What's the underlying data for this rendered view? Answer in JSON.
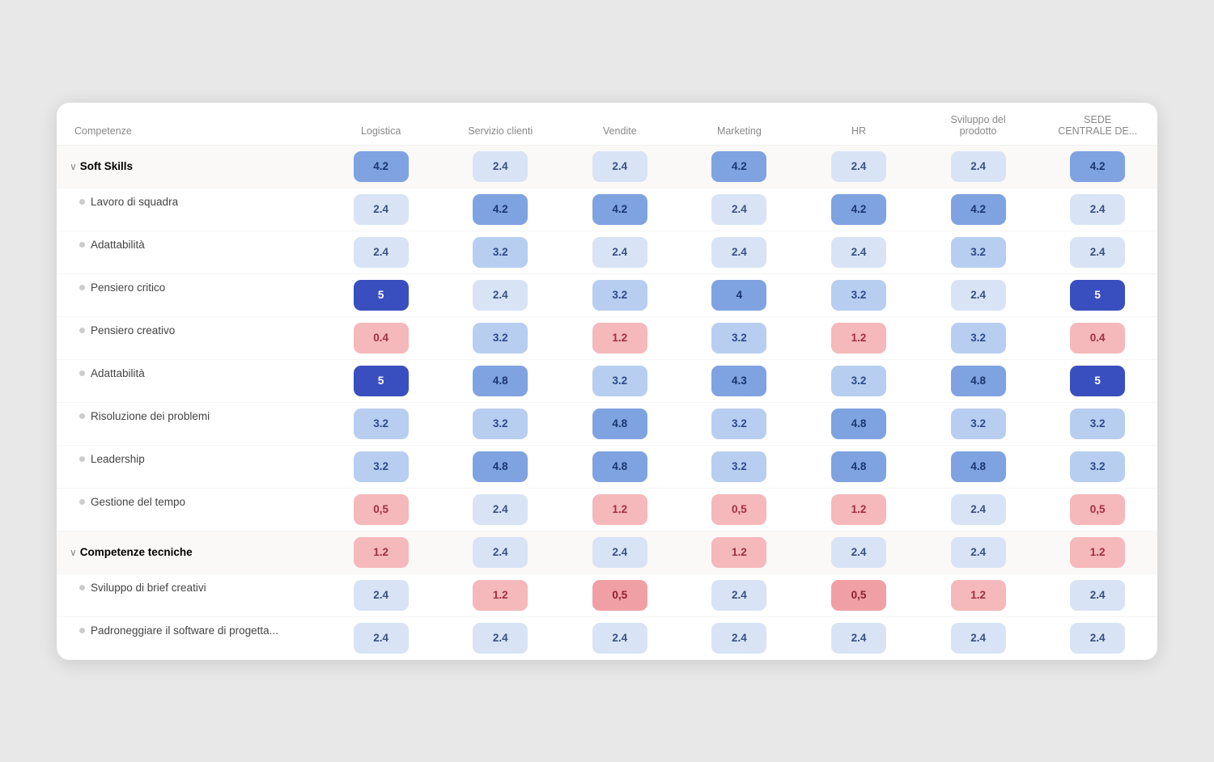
{
  "table": {
    "columns": [
      {
        "id": "competenze",
        "label": "Competenze"
      },
      {
        "id": "logistica",
        "label": "Logistica"
      },
      {
        "id": "servizio",
        "label": "Servizio clienti"
      },
      {
        "id": "vendite",
        "label": "Vendite"
      },
      {
        "id": "marketing",
        "label": "Marketing"
      },
      {
        "id": "hr",
        "label": "HR"
      },
      {
        "id": "sviluppo",
        "label": "Sviluppo del\nprodotto"
      },
      {
        "id": "sede",
        "label": "SEDE\nCENTRALE DE..."
      }
    ],
    "groups": [
      {
        "label": "Soft Skills",
        "values": [
          "4.2",
          "2.4",
          "2.4",
          "4.2",
          "2.4",
          "2.4",
          "4.2"
        ],
        "colors": [
          "c-blue-medium",
          "c-neutral",
          "c-neutral",
          "c-blue-medium",
          "c-neutral",
          "c-neutral",
          "c-blue-medium"
        ],
        "rows": [
          {
            "label": "Lavoro di squadra",
            "values": [
              "2.4",
              "4.2",
              "4.2",
              "2.4",
              "4.2",
              "4.2",
              "2.4"
            ],
            "colors": [
              "c-neutral",
              "c-blue-medium",
              "c-blue-medium",
              "c-neutral",
              "c-blue-medium",
              "c-blue-medium",
              "c-neutral"
            ]
          },
          {
            "label": "Adattabilità",
            "values": [
              "2.4",
              "3.2",
              "2.4",
              "2.4",
              "2.4",
              "3.2",
              "2.4"
            ],
            "colors": [
              "c-neutral",
              "c-blue-light",
              "c-neutral",
              "c-neutral",
              "c-neutral",
              "c-blue-light",
              "c-neutral"
            ]
          },
          {
            "label": "Pensiero critico",
            "values": [
              "5",
              "2.4",
              "3.2",
              "4",
              "3.2",
              "2.4",
              "5"
            ],
            "colors": [
              "c-blue-deep",
              "c-neutral",
              "c-blue-light",
              "c-blue-medium",
              "c-blue-light",
              "c-neutral",
              "c-blue-deep"
            ]
          },
          {
            "label": "Pensiero creativo",
            "values": [
              "0.4",
              "3.2",
              "1.2",
              "3.2",
              "1.2",
              "3.2",
              "0.4"
            ],
            "colors": [
              "c-pink-light",
              "c-blue-light",
              "c-pink-light",
              "c-blue-light",
              "c-pink-light",
              "c-blue-light",
              "c-pink-light"
            ]
          },
          {
            "label": "Adattabilità",
            "values": [
              "5",
              "4.8",
              "3.2",
              "4.3",
              "3.2",
              "4.8",
              "5"
            ],
            "colors": [
              "c-blue-deep",
              "c-blue-medium",
              "c-blue-light",
              "c-blue-medium",
              "c-blue-light",
              "c-blue-medium",
              "c-blue-deep"
            ]
          },
          {
            "label": "Risoluzione dei problemi",
            "values": [
              "3.2",
              "3.2",
              "4.8",
              "3.2",
              "4.8",
              "3.2",
              "3.2"
            ],
            "colors": [
              "c-blue-light",
              "c-blue-light",
              "c-blue-medium",
              "c-blue-light",
              "c-blue-medium",
              "c-blue-light",
              "c-blue-light"
            ]
          },
          {
            "label": "Leadership",
            "values": [
              "3.2",
              "4.8",
              "4.8",
              "3.2",
              "4.8",
              "4.8",
              "3.2"
            ],
            "colors": [
              "c-blue-light",
              "c-blue-medium",
              "c-blue-medium",
              "c-blue-light",
              "c-blue-medium",
              "c-blue-medium",
              "c-blue-light"
            ]
          },
          {
            "label": "Gestione del tempo",
            "values": [
              "0,5",
              "2.4",
              "1.2",
              "0,5",
              "1.2",
              "2.4",
              "0,5"
            ],
            "colors": [
              "c-pink-light",
              "c-neutral",
              "c-pink-light",
              "c-pink-light",
              "c-pink-light",
              "c-neutral",
              "c-pink-light"
            ]
          }
        ]
      },
      {
        "label": "Competenze tecniche",
        "values": [
          "1.2",
          "2.4",
          "2.4",
          "1.2",
          "2.4",
          "2.4",
          "1.2"
        ],
        "colors": [
          "c-pink-light",
          "c-neutral",
          "c-neutral",
          "c-pink-light",
          "c-neutral",
          "c-neutral",
          "c-pink-light"
        ],
        "rows": [
          {
            "label": "Sviluppo di brief creativi",
            "values": [
              "2.4",
              "1.2",
              "0,5",
              "2.4",
              "0,5",
              "1.2",
              "2.4"
            ],
            "colors": [
              "c-neutral",
              "c-pink-light",
              "c-pink-medium",
              "c-neutral",
              "c-pink-medium",
              "c-pink-light",
              "c-neutral"
            ]
          },
          {
            "label": "Padroneggiare il software di progetta...",
            "values": [
              "2.4",
              "2.4",
              "2.4",
              "2.4",
              "2.4",
              "2.4",
              "2.4"
            ],
            "colors": [
              "c-neutral",
              "c-neutral",
              "c-neutral",
              "c-neutral",
              "c-neutral",
              "c-neutral",
              "c-neutral"
            ]
          }
        ]
      }
    ]
  }
}
